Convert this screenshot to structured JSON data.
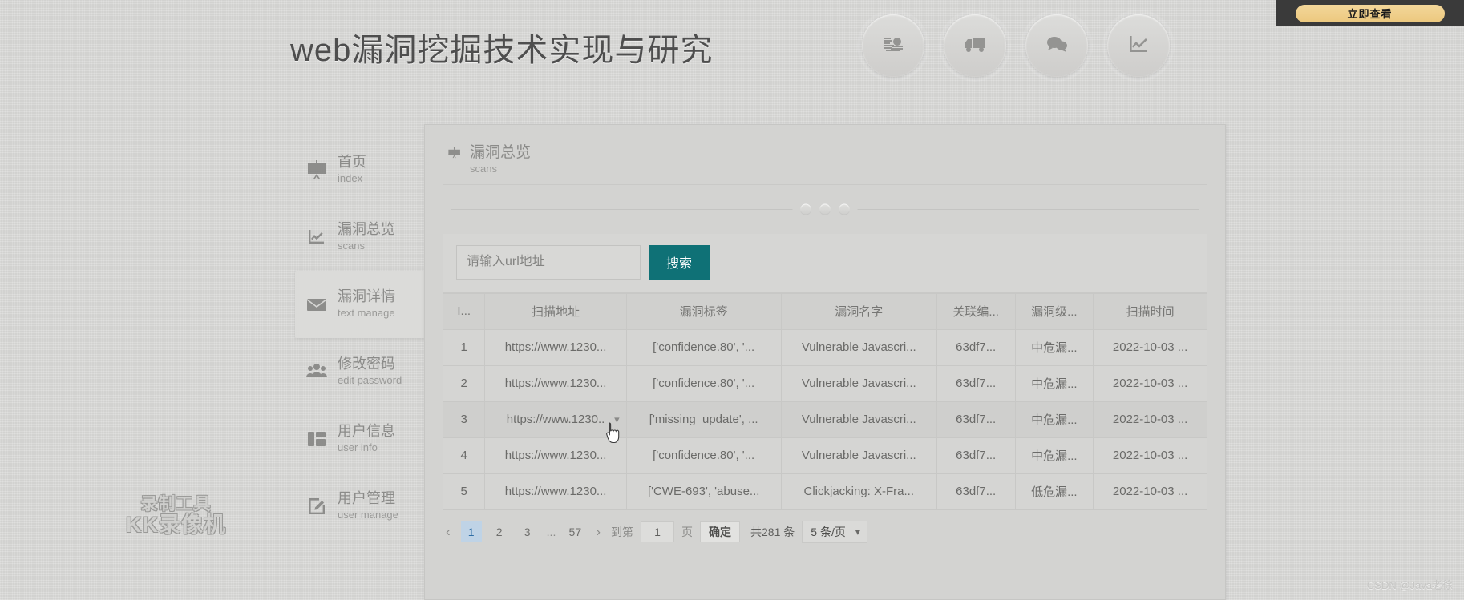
{
  "ad": {
    "button_label": "立即查看"
  },
  "page": {
    "title": "web漏洞挖掘技术实现与研究"
  },
  "header_icons": [
    {
      "name": "money-icon"
    },
    {
      "name": "truck-icon"
    },
    {
      "name": "chat-icon"
    },
    {
      "name": "chart-icon"
    }
  ],
  "sidebar": {
    "items": [
      {
        "cn": "首页",
        "en": "index",
        "icon": "presentation-icon",
        "active": false
      },
      {
        "cn": "漏洞总览",
        "en": "scans",
        "icon": "line-chart-icon",
        "active": false
      },
      {
        "cn": "漏洞详情",
        "en": "text manage",
        "icon": "envelope-icon",
        "active": true
      },
      {
        "cn": "修改密码",
        "en": "edit password",
        "icon": "users-icon",
        "active": false
      },
      {
        "cn": "用户信息",
        "en": "user info",
        "icon": "layout-icon",
        "active": false
      },
      {
        "cn": "用户管理",
        "en": "user manage",
        "icon": "edit-square-icon",
        "active": false
      }
    ]
  },
  "card": {
    "title_cn": "漏洞总览",
    "title_en": "scans",
    "carousel_dots": 3
  },
  "search": {
    "placeholder": "请输入url地址",
    "value": "",
    "button_label": "搜索",
    "button_color": "#0f7176"
  },
  "table": {
    "columns": [
      "I...",
      "扫描地址",
      "漏洞标签",
      "漏洞名字",
      "关联编...",
      "漏洞级...",
      "扫描时间"
    ],
    "rows": [
      {
        "id": "1",
        "url": "https://www.1230...",
        "tags": "['confidence.80', '...",
        "name": "Vulnerable Javascri...",
        "ref": "63df7...",
        "level": "中危漏...",
        "time": "2022-10-03 ...",
        "caret": false
      },
      {
        "id": "2",
        "url": "https://www.1230...",
        "tags": "['confidence.80', '...",
        "name": "Vulnerable Javascri...",
        "ref": "63df7...",
        "level": "中危漏...",
        "time": "2022-10-03 ...",
        "caret": false
      },
      {
        "id": "3",
        "url": "https://www.1230..",
        "tags": "['missing_update', ...",
        "name": "Vulnerable Javascri...",
        "ref": "63df7...",
        "level": "中危漏...",
        "time": "2022-10-03 ...",
        "caret": true
      },
      {
        "id": "4",
        "url": "https://www.1230...",
        "tags": "['confidence.80', '...",
        "name": "Vulnerable Javascri...",
        "ref": "63df7...",
        "level": "中危漏...",
        "time": "2022-10-03 ...",
        "caret": false
      },
      {
        "id": "5",
        "url": "https://www.1230...",
        "tags": "['CWE-693', 'abuse...",
        "name": "Clickjacking: X-Fra...",
        "ref": "63df7...",
        "level": "低危漏...",
        "time": "2022-10-03 ...",
        "caret": false
      }
    ]
  },
  "pagination": {
    "prev_icon": "chevron-left-icon",
    "next_icon": "chevron-right-icon",
    "pages": [
      "1",
      "2",
      "3"
    ],
    "ellipsis": "...",
    "last_page": "57",
    "current_page": "1",
    "jump_label": "到第",
    "jump_value": "1",
    "page_unit": "页",
    "confirm_label": "确定",
    "total_label": "共281 条",
    "page_size": "5 条/页",
    "chevron": "chevron-down-icon",
    "active_bg": "#bfd3e6"
  },
  "watermarks": {
    "kk_line1": "录制工具",
    "kk_line2": "KK录像机",
    "csdn": "CSDN @Java老徐"
  }
}
